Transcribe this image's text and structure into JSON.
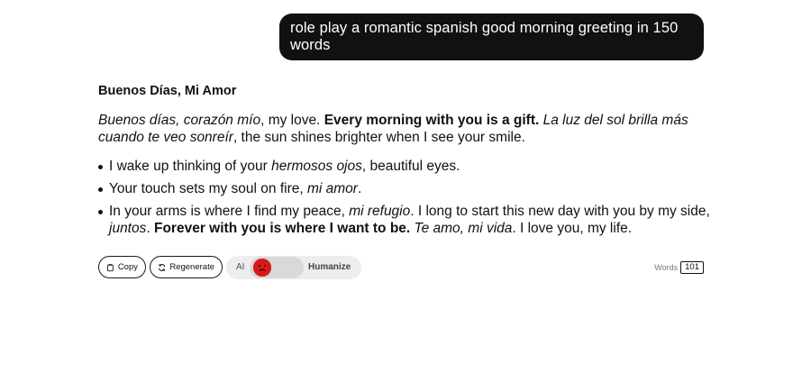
{
  "user_message": "role play a romantic spanish good morning greeting in 150 words",
  "response": {
    "title": "Buenos Días, Mi Amor",
    "paragraph": {
      "s1_italic": "Buenos días, corazón mío",
      "s1_plain": ", my love. ",
      "s2_bold": "Every morning with you is a gift.",
      "s3_space": " ",
      "s3_italic": "La luz del sol brilla más cuando te veo sonreír",
      "s3_plain": ", the sun shines brighter when I see your smile."
    },
    "bullets": [
      {
        "a": "I wake up thinking of your ",
        "b_italic": "hermosos ojos",
        "c": ", beautiful eyes."
      },
      {
        "a": "Your touch sets my soul on fire, ",
        "b_italic": "mi amor",
        "c": "."
      },
      {
        "a": "In your arms is where I find my peace, ",
        "b_italic": "mi refugio",
        "c": ". I long to start this new day with you by my side, ",
        "d_italic": "juntos",
        "e": ". ",
        "f_bold": "Forever with you is where I want to be.",
        "g": " ",
        "h_italic": "Te amo, mi vida",
        "i": ". I love you, my life."
      }
    ]
  },
  "actions": {
    "copy_label": "Copy",
    "regenerate_label": "Regenerate",
    "humanize": {
      "ai_label": "AI",
      "label": "Humanize",
      "knob_icon": "sad-face-icon",
      "knob_color": "#d61a1a"
    },
    "words_label": "Words",
    "word_count": "101"
  },
  "icons": {
    "copy": "clipboard-icon",
    "regenerate": "refresh-icon"
  }
}
